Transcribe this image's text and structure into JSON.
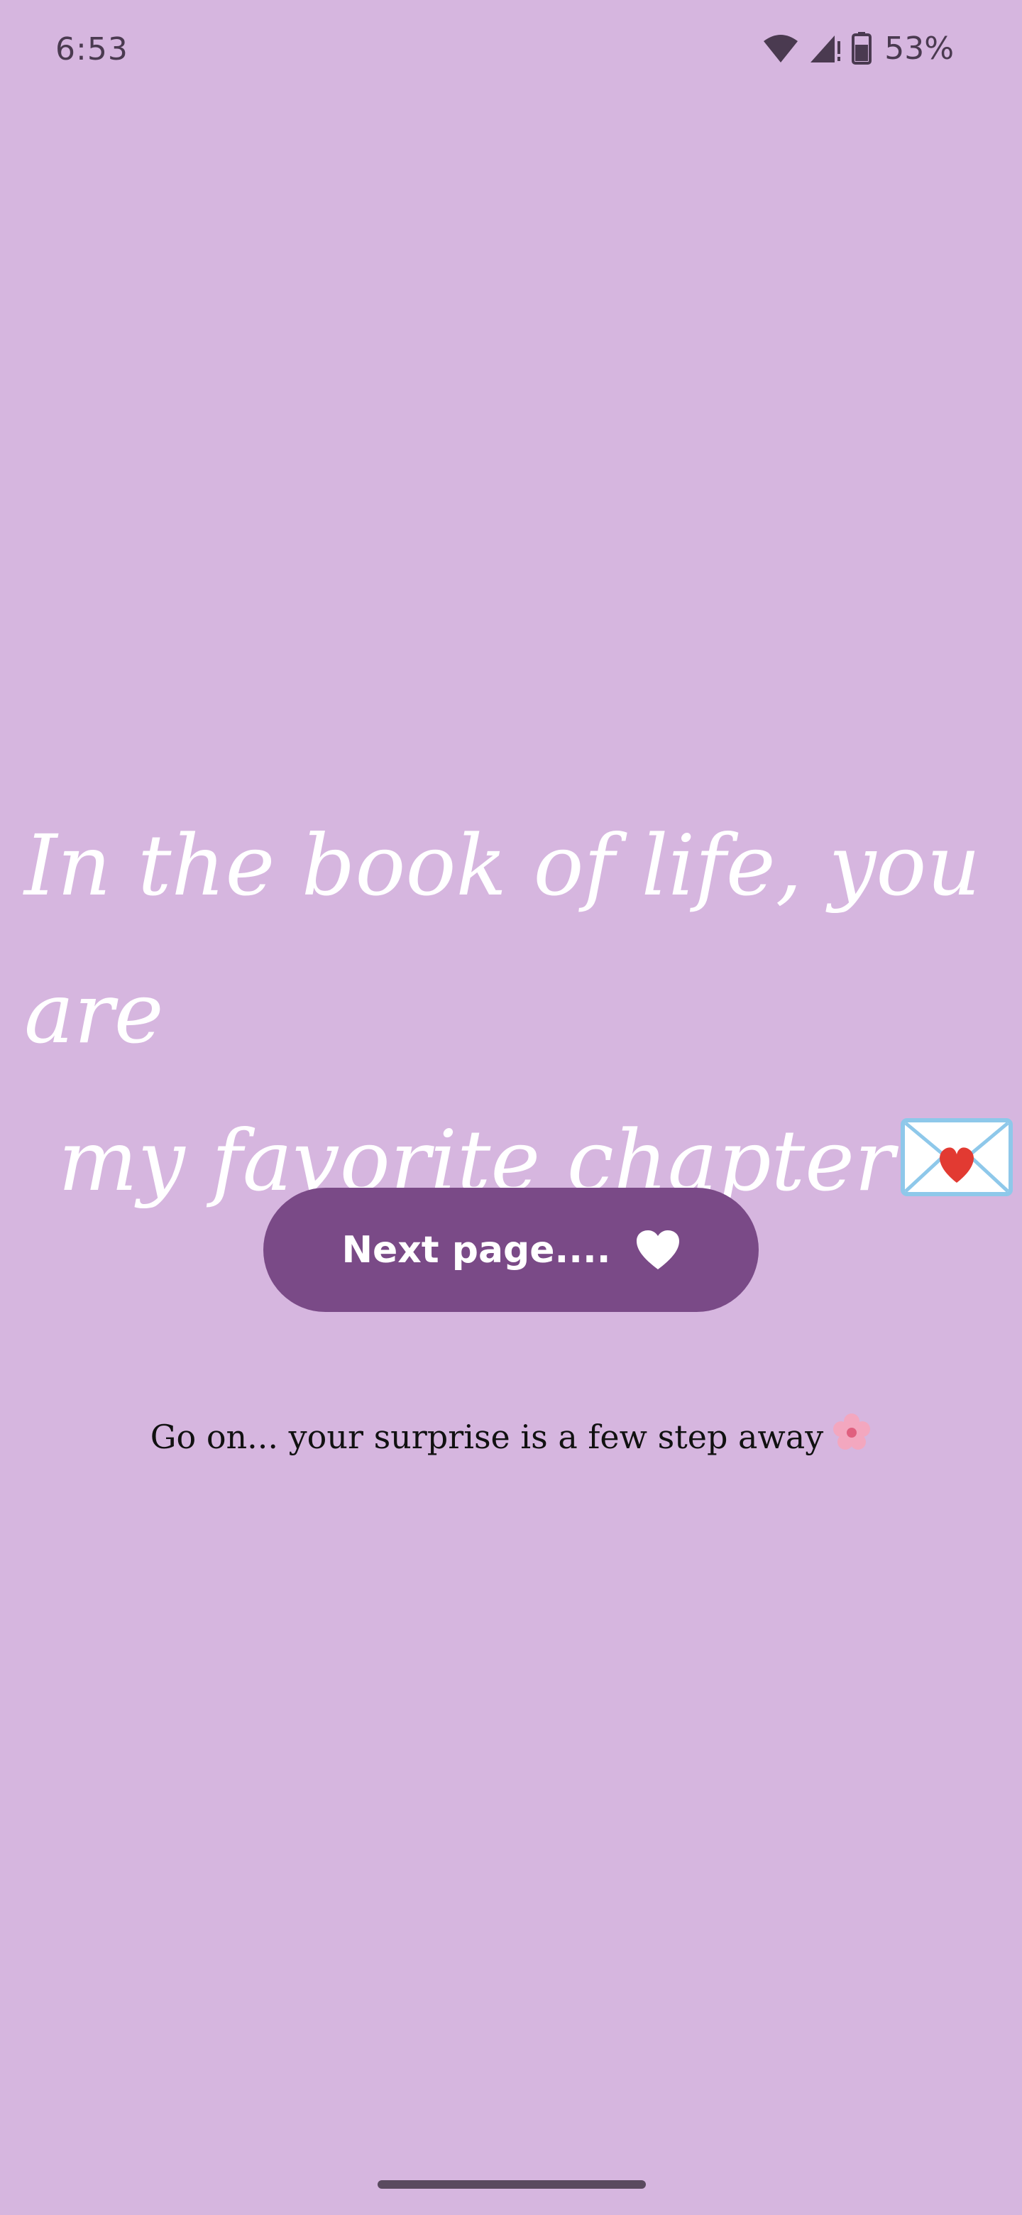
{
  "status_bar": {
    "time": "6:53",
    "battery_percent": "53%",
    "icons": [
      "wifi-icon",
      "cellular-signal-icon",
      "battery-icon"
    ]
  },
  "main": {
    "headline_line1": "In the book of life, you are",
    "headline_line2": "my favorite chapter",
    "headline_emoji": "envelope-with-heart-icon",
    "next_button": {
      "label": "Next page....",
      "icon": "heart-icon"
    },
    "hint": "Go on... your surprise is a few step away",
    "hint_emoji": "cherry-blossom-icon"
  },
  "colors": {
    "background": "#d6b6df",
    "button": "#7a4a87",
    "headline_text": "#ffffff",
    "hint_text": "#111111"
  }
}
